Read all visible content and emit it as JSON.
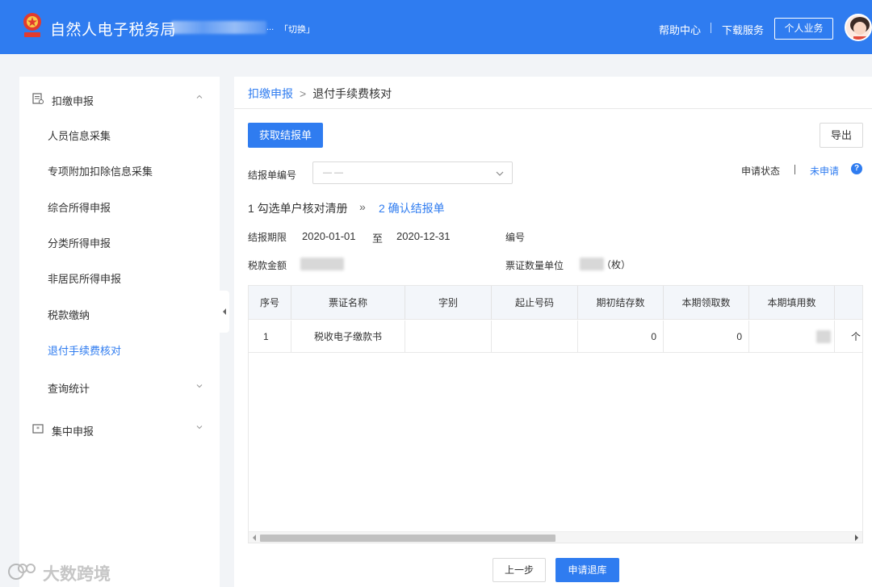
{
  "header": {
    "app_title": "自然人电子税务局",
    "ellipsis": "...",
    "switch_label": "「切换」",
    "help_label": "帮助中心",
    "download_label": "下载服务",
    "personal_label": "个人业务"
  },
  "sidebar": {
    "groups": [
      {
        "label": "扣缴申报",
        "icon": "form-icon",
        "expanded": true
      },
      {
        "label": "集中申报",
        "icon": "batch-icon",
        "expanded": false
      }
    ],
    "items": [
      {
        "label": "人员信息采集"
      },
      {
        "label": "专项附加扣除信息采集"
      },
      {
        "label": "综合所得申报"
      },
      {
        "label": "分类所得申报"
      },
      {
        "label": "非居民所得申报"
      },
      {
        "label": "税款缴纳"
      },
      {
        "label": "退付手续费核对",
        "active": true
      },
      {
        "label": "查询统计",
        "expandable": true
      }
    ]
  },
  "breadcrumb": {
    "parent": "扣缴申报",
    "separator": ">",
    "current": "退付手续费核对"
  },
  "toolbar": {
    "fetch_label": "获取结报单",
    "export_label": "导出"
  },
  "form": {
    "report_no_label": "结报单编号",
    "report_no_value": "— —",
    "status_label": "申请状态",
    "status_value": "未申请",
    "help_icon": "?",
    "period_label": "结报期限",
    "period_start": "2020-01-01",
    "period_to": "至",
    "period_end": "2020-12-31",
    "number_label": "编号",
    "tax_amount_label": "税款金额",
    "ticket_unit_label": "票证数量单位",
    "ticket_unit_value": "（枚）"
  },
  "steps": {
    "step1": "1 勾选单户核对清册",
    "arrow": "»",
    "step2": "2 确认结报单"
  },
  "table": {
    "columns": [
      "序号",
      "票证名称",
      "字别",
      "起止号码",
      "期初结存数",
      "本期领取数",
      "本期填用数",
      ""
    ],
    "rows": [
      {
        "seq": "1",
        "name": "税收电子缴款书",
        "series": "",
        "range": "",
        "opening": "0",
        "received": "0",
        "used": "",
        "unit": "个"
      }
    ]
  },
  "footer": {
    "prev_label": "上一步",
    "apply_label": "申请退库"
  },
  "watermark": {
    "text": "大数跨境"
  },
  "colors": {
    "brand_blue": "#2f7cf0",
    "header_bg": "#2f7cf0",
    "page_bg": "#f2f4f7"
  }
}
